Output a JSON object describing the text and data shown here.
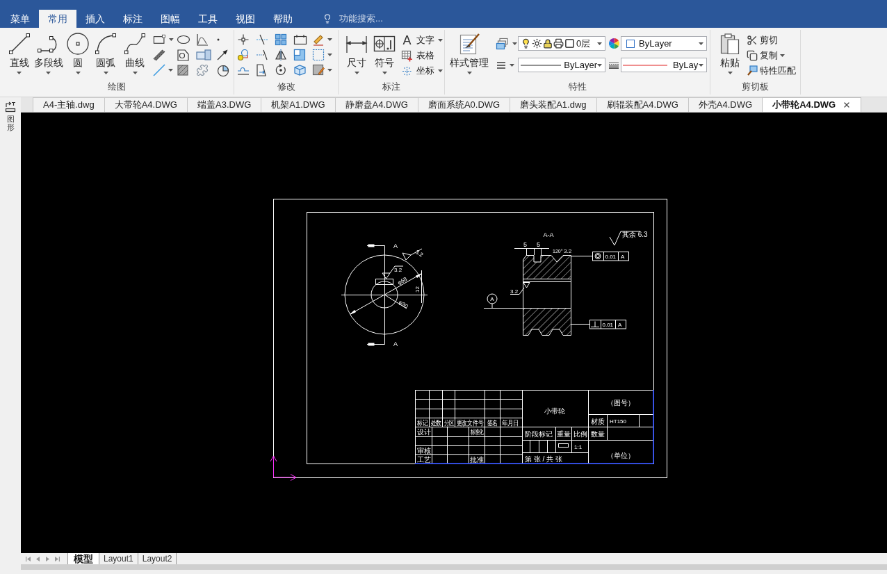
{
  "menu_bar": {
    "tabs": [
      {
        "label": "菜单",
        "selected": false
      },
      {
        "label": "常用",
        "selected": true
      },
      {
        "label": "插入",
        "selected": false
      },
      {
        "label": "标注",
        "selected": false
      },
      {
        "label": "图幅",
        "selected": false
      },
      {
        "label": "工具",
        "selected": false
      },
      {
        "label": "视图",
        "selected": false
      },
      {
        "label": "帮助",
        "selected": false
      }
    ],
    "search": {
      "placeholder": "功能搜索..."
    }
  },
  "ribbon": {
    "draw": {
      "title": "绘图",
      "tools": [
        "直线",
        "多段线",
        "圆",
        "圆弧",
        "曲线"
      ]
    },
    "modify": {
      "title": "修改"
    },
    "annotate": {
      "title": "标注",
      "tools": [
        "尺寸",
        "符号"
      ],
      "small_tools": [
        {
          "glyph": "A",
          "label": "文字",
          "dropdown": true
        },
        {
          "label": "表格",
          "dropdown": false
        },
        {
          "label": "坐标",
          "dropdown": true
        }
      ]
    },
    "properties": {
      "title": "特性",
      "style_button": "样式管理",
      "layer": "0层",
      "color_setting": "ByLayer",
      "linetype": "ByLayer",
      "lineweight": "ByLay"
    },
    "clipboard": {
      "title": "剪切板",
      "paste": "粘贴",
      "small_tools": [
        {
          "label": "剪切",
          "dropdown": false
        },
        {
          "label": "复制",
          "dropdown": true
        },
        {
          "label": "特性匹配",
          "dropdown": false
        }
      ]
    }
  },
  "document_tabs": [
    {
      "label": "A4-主轴.dwg",
      "selected": false
    },
    {
      "label": "大带轮A4.DWG",
      "selected": false
    },
    {
      "label": "端盖A3.DWG",
      "selected": false
    },
    {
      "label": "机架A1.DWG",
      "selected": false
    },
    {
      "label": "静磨盘A4.DWG",
      "selected": false
    },
    {
      "label": "磨面系统A0.DWG",
      "selected": false
    },
    {
      "label": "磨头装配A1.dwg",
      "selected": false
    },
    {
      "label": "刷辊装配A4.DWG",
      "selected": false
    },
    {
      "label": "外壳A4.DWG",
      "selected": false
    },
    {
      "label": "小带轮A4.DWG",
      "selected": true
    }
  ],
  "side_panel": {
    "label": "图形"
  },
  "drawing": {
    "front_view": {
      "section_marks": [
        "A",
        "A"
      ],
      "roughness": [
        "3.2",
        "3.2"
      ],
      "outer_diameter": "φ68",
      "bore_diameter": "φ30",
      "key_dimension": "12"
    },
    "section_view": {
      "title": "A-A",
      "groove_widths": [
        "5",
        "5"
      ],
      "groove_angle": "120°",
      "roughness": [
        "3.2",
        "3.2"
      ],
      "datum": "A",
      "tolerances": [
        {
          "kind": "concentricity",
          "value": "0.01",
          "datum": "A"
        },
        {
          "kind": "perpendicularity",
          "value": "0.01",
          "datum": "A"
        }
      ]
    },
    "general_roughness": "其余 6.3",
    "title_block": {
      "revision_headers": [
        "标记",
        "处数",
        "分区",
        "更改文件号",
        "签名",
        "年月日"
      ],
      "designer_label": "设计",
      "standardization_label": "标准化",
      "reviewer_label": "审核",
      "process_label": "工艺",
      "approval_label": "批准",
      "part_name": "小带轮",
      "drawing_number": "（图号）",
      "material_label": "材质",
      "material": "HT150",
      "quantity_label": "数量",
      "stage_label": "阶段标记",
      "weight_label": "重量",
      "scale_label": "比例",
      "scale": "1:1",
      "sheet": "第 张 / 共 张",
      "company": "（单位）"
    }
  },
  "layout_tabs": [
    {
      "label": "模型",
      "selected": true
    },
    {
      "label": "Layout1",
      "selected": false
    },
    {
      "label": "Layout2",
      "selected": false
    }
  ]
}
